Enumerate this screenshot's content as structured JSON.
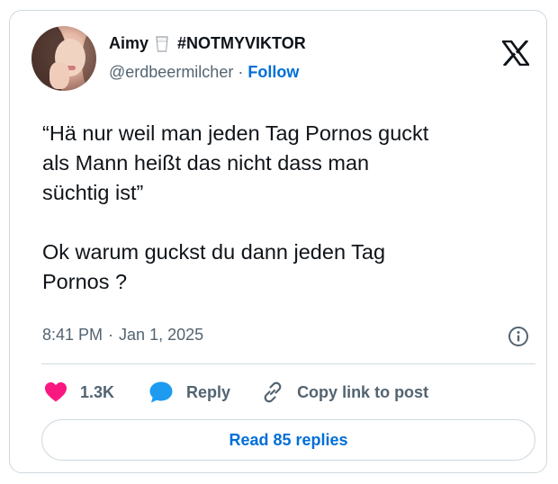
{
  "author": {
    "display_name": "Aimy",
    "name_suffix": "#NOTMYVIKTOR",
    "handle": "@erdbeermilcher",
    "separator": "·",
    "follow_label": "Follow"
  },
  "tweet": {
    "text": "“Hä nur weil man jeden Tag Pornos guckt\nals Mann heißt das nicht dass man\nsüchtig ist”\n\nOk warum guckst du dann jeden Tag\nPornos ?",
    "time": "8:41 PM",
    "separator": "·",
    "date": "Jan 1, 2025"
  },
  "actions": {
    "likes_count": "1.3K",
    "reply_label": "Reply",
    "copy_link_label": "Copy link to post"
  },
  "read_replies_label": "Read 85 replies",
  "icons": {
    "platform": "x-logo-icon",
    "info": "info-icon",
    "like": "heart-icon",
    "reply": "speech-bubble-icon",
    "copy": "link-icon",
    "name_emoji": "glass-of-milk-icon"
  },
  "colors": {
    "like": "#f91880",
    "reply": "#1d9bf0",
    "link": "#006fd6",
    "secondary_text": "#536471",
    "border": "#cfd9de"
  }
}
